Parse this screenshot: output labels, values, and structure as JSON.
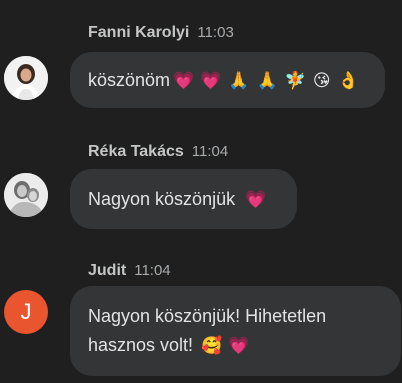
{
  "messages": [
    {
      "sender": "Fanni Karolyi",
      "time": "11:03",
      "text": "köszönöm",
      "emojis": [
        "💗",
        "💗",
        "🙏",
        "🙏",
        "🧚",
        "😘",
        "👌"
      ]
    },
    {
      "sender": "Réka Takács",
      "time": "11:04",
      "text": "Nagyon köszönjük",
      "emojis": [
        "💗"
      ]
    },
    {
      "sender": "Judit",
      "time": "11:04",
      "avatar_initial": "J",
      "text_line1": "Nagyon köszönjük! Hihetetlen",
      "text_line2": "hasznos volt!",
      "emojis": [
        "🥰",
        "💗"
      ]
    }
  ],
  "colors": {
    "background": "#1f1f1f",
    "bubble": "#333537",
    "avatar_j": "#e8552f",
    "heart": "#f0508c"
  }
}
